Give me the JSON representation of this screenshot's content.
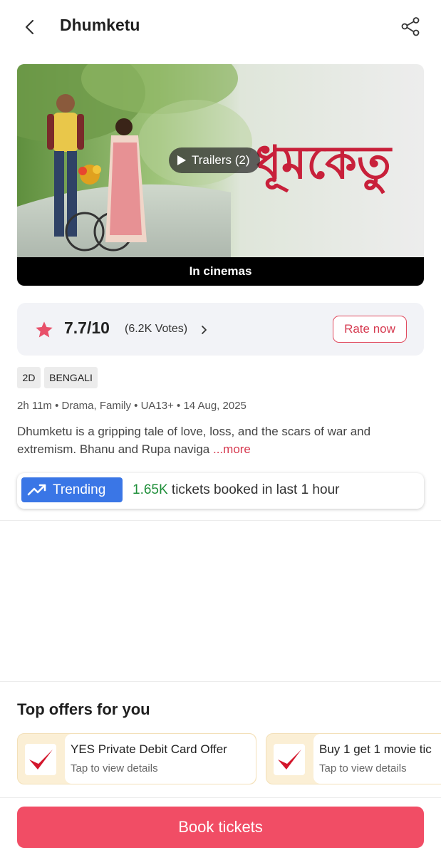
{
  "header": {
    "title": "Dhumketu",
    "back_icon": "chevron-left-icon",
    "share_icon": "share-icon"
  },
  "poster": {
    "title_art": "ধূমকেতু",
    "trailer_label": "Trailers (2)",
    "status_strip": "In cinemas"
  },
  "rating": {
    "score": "7.7/10",
    "votes": "(6.2K Votes)",
    "rate_button": "Rate now",
    "star_color": "#e8506a"
  },
  "tags": [
    "2D",
    "BENGALI"
  ],
  "meta": "2h 11m • Drama, Family • UA13+ • 14 Aug, 2025",
  "description": {
    "text": "Dhumketu is a gripping tale of love, loss, and the scars of war and extremism. Bhanu and Rupa naviga",
    "more": " ...more"
  },
  "trending": {
    "badge": "Trending",
    "count": "1.65K",
    "text": " tickets booked in last 1 hour",
    "badge_color": "#3a76e6",
    "count_color": "#1f8f3a"
  },
  "offers": {
    "title": "Top offers for you",
    "items": [
      {
        "title": "YES Private Debit Card Offer",
        "subtitle": "Tap to view details"
      },
      {
        "title": "Buy 1 get 1 movie tic",
        "subtitle": "Tap to view details"
      }
    ]
  },
  "book_button": {
    "label": "Book tickets",
    "color": "#f14d65"
  }
}
